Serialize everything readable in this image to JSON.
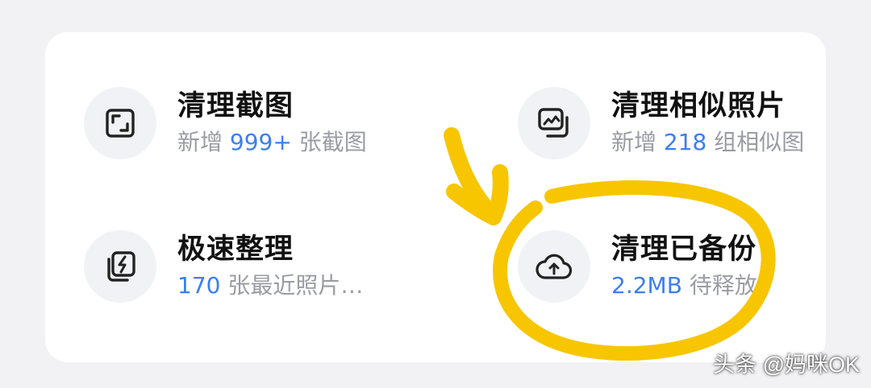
{
  "tiles": [
    {
      "title": "清理截图",
      "sub_prefix": "新增",
      "highlight": "999+",
      "sub_suffix": "张截图",
      "icon": "screenshot-frame-icon"
    },
    {
      "title": "清理相似照片",
      "sub_prefix": "新增",
      "highlight": "218",
      "sub_suffix": "组相似图",
      "icon": "similar-photos-icon"
    },
    {
      "title": "极速整理",
      "sub_prefix": "",
      "highlight": "170",
      "sub_suffix": "张最近照片…",
      "icon": "quick-organize-icon"
    },
    {
      "title": "清理已备份",
      "sub_prefix": "",
      "highlight": "2.2MB",
      "sub_suffix": "待释放",
      "icon": "cloud-upload-icon"
    }
  ],
  "watermark": "头条 @妈咪OK",
  "colors": {
    "highlight": "#3b7ef0",
    "subtext": "#9a9ca3",
    "title": "#111111",
    "annotation": "#f7c600"
  }
}
